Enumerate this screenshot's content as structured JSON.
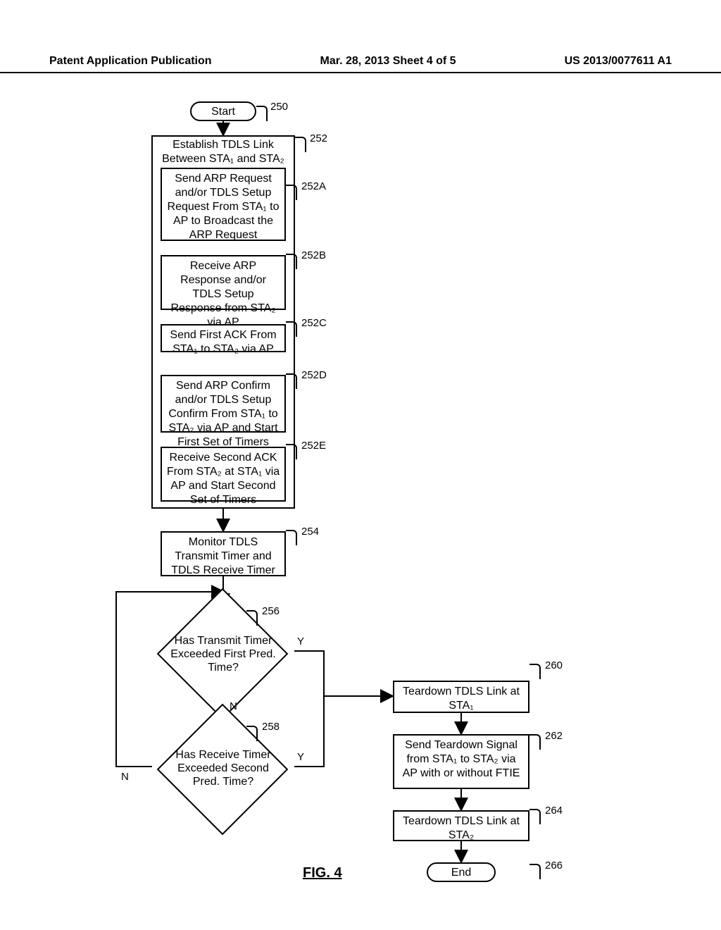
{
  "header": {
    "left": "Patent Application Publication",
    "mid": "Mar. 28, 2013  Sheet 4 of 5",
    "right": "US 2013/0077611 A1"
  },
  "nodes": {
    "start": "Start",
    "b252": "Establish TDLS Link Between STA₁ and STA₂",
    "b252A": "Send ARP Request and/or TDLS Setup Request From STA₁ to AP to Broadcast the ARP Request",
    "b252B": "Receive ARP Response and/or TDLS Setup Response from STA₂ via AP",
    "b252C": "Send First ACK From STA₁ to STA₂ via AP",
    "b252D": "Send ARP Confirm and/or TDLS Setup Confirm From STA₁ to STA₂ via AP and Start First Set of Timers",
    "b252E": "Receive Second ACK From STA₂ at STA₁ via AP and Start Second Set of Timers",
    "b254": "Monitor TDLS Transmit Timer and TDLS Receive Timer",
    "d256": "Has Transmit Timer Exceeded First Pred. Time?",
    "d258": "Has Receive Timer Exceeded Second Pred. Time?",
    "b260": "Teardown TDLS Link at STA₁",
    "b262": "Send Teardown Signal from STA₁ to STA₂ via AP with or without FTIE",
    "b264": "Teardown TDLS Link at STA₂",
    "end": "End"
  },
  "refs": {
    "r250": "250",
    "r252": "252",
    "r252A": "252A",
    "r252B": "252B",
    "r252C": "252C",
    "r252D": "252D",
    "r252E": "252E",
    "r254": "254",
    "r256": "256",
    "r258": "258",
    "r260": "260",
    "r262": "262",
    "r264": "264",
    "r266": "266"
  },
  "branch": {
    "Y": "Y",
    "N": "N"
  },
  "figure": "FIG. 4"
}
